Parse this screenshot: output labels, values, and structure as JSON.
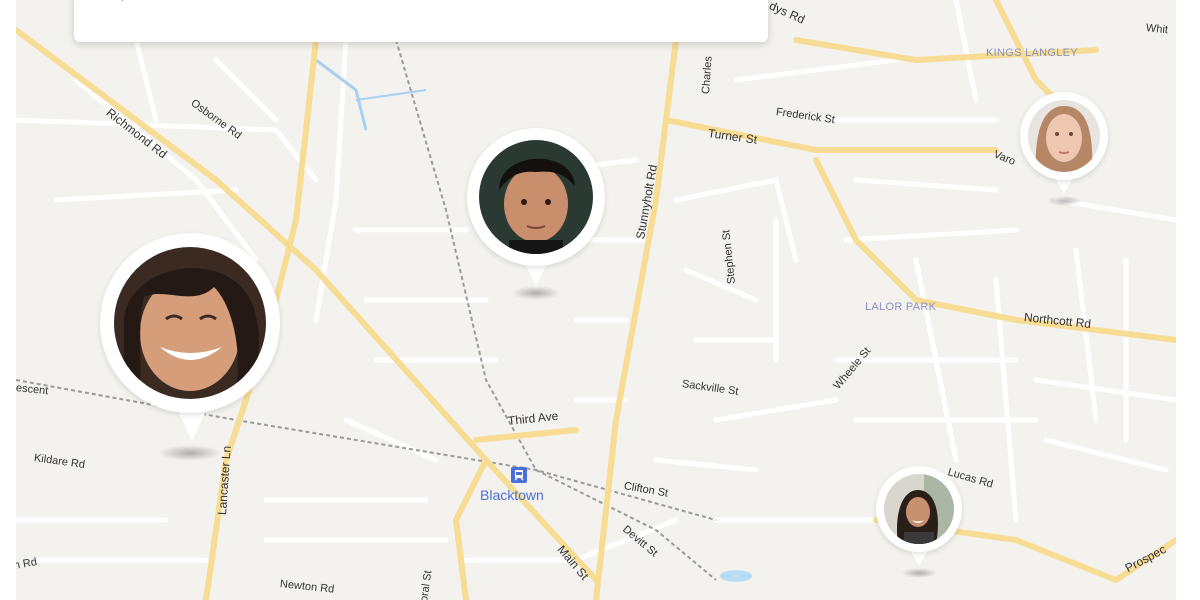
{
  "map": {
    "roads": {
      "richmond": "Richmond Rd",
      "osborne": "Osborne Rd",
      "stunnyholt": "Stunnyholt Rd",
      "turner": "Turner St",
      "frederick": "Frederick St",
      "charles": "Charles",
      "kings_rd": "dys Rd",
      "white": "Whit",
      "varo": "Varo",
      "stephen": "Stephen St",
      "northcott": "Northcott Rd",
      "wheele": "Wheele St",
      "sackville": "Sackville St",
      "third": "Third Ave",
      "crescent": "escent",
      "kildare": "Kildare Rd",
      "lancaster": "Lancaster Ln",
      "clifton": "Clifton St",
      "devitt": "Devitt St",
      "main": "Main St",
      "lucas": "Lucas Rd",
      "prospect": "Prospec",
      "newton": "Newton Rd",
      "oral": "oral St",
      "rh": "h Rd"
    },
    "suburbs": {
      "kings_langley": "KINGS LANGLEY",
      "lalor_park": "LALOR PARK"
    },
    "station": "Blacktown"
  },
  "colors": {
    "major_road": "#f7dc94",
    "minor_road": "#ffffff",
    "map_bg": "#f4f2ee",
    "station_blue": "#4a6fd6"
  },
  "markers": [
    {
      "name": "smiling-person"
    },
    {
      "name": "young-man"
    },
    {
      "name": "woman-top-right"
    },
    {
      "name": "woman-bottom-right"
    }
  ]
}
